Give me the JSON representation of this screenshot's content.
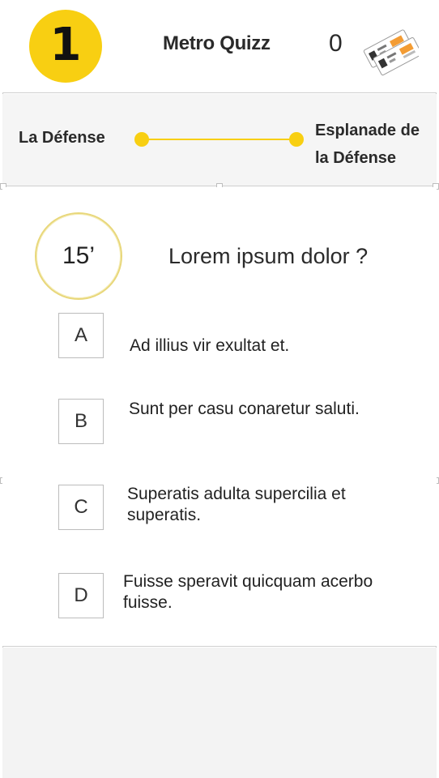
{
  "header": {
    "line_number": "1",
    "title": "Metro Quizz",
    "score": "0",
    "tickets_icon": "metro-tickets-icon",
    "accent_color": "#f8cf12"
  },
  "route": {
    "from": "La Défense",
    "to": "Esplanade de la Défense"
  },
  "question": {
    "timer": "15’",
    "text": "Lorem ipsum dolor ?"
  },
  "answers": [
    {
      "letter": "A",
      "text": "Ad illius vir exultat et."
    },
    {
      "letter": "B",
      "text": "Sunt per casu conaretur saluti."
    },
    {
      "letter": "C",
      "text": "Superatis adulta supercilia et superatis."
    },
    {
      "letter": "D",
      "text": "Fuisse speravit quicquam acerbo fuisse."
    }
  ]
}
